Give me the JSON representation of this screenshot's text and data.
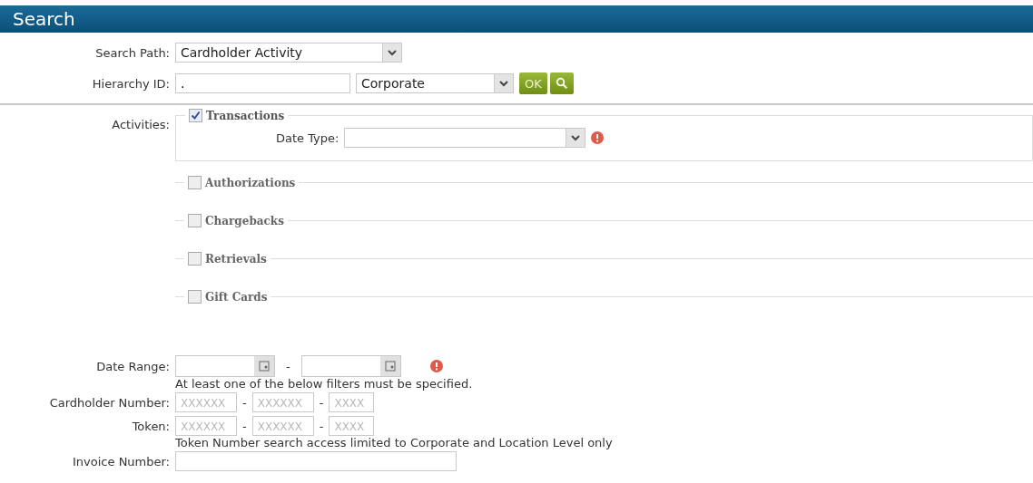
{
  "header": {
    "title": "Search"
  },
  "search_path": {
    "label": "Search Path:",
    "value": "Cardholder Activity"
  },
  "hierarchy": {
    "label": "Hierarchy ID:",
    "value": ".",
    "level_value": "Corporate",
    "ok_button": "OK"
  },
  "activities": {
    "label": "Activities:",
    "items": [
      {
        "label": "Transactions",
        "checked": true,
        "expanded": true,
        "date_type_label": "Date Type:",
        "required": true
      },
      {
        "label": "Authorizations",
        "checked": false,
        "expanded": false
      },
      {
        "label": "Chargebacks",
        "checked": false,
        "expanded": false
      },
      {
        "label": "Retrievals",
        "checked": false,
        "expanded": false
      },
      {
        "label": "Gift Cards",
        "checked": false,
        "expanded": false
      }
    ]
  },
  "date_range": {
    "label": "Date Range:",
    "separator": "-",
    "required": true
  },
  "filters_note": "At least one of the below filters must be specified.",
  "number_rows": [
    {
      "label": "Cardholder Number:",
      "placeholders": [
        "XXXXXX",
        "XXXXXX",
        "XXXX"
      ],
      "separators": [
        "-",
        "-"
      ]
    },
    {
      "label": "Token:",
      "placeholders": [
        "XXXXXX",
        "XXXXXX",
        "XXXX"
      ],
      "separators": [
        "-",
        "-"
      ]
    }
  ],
  "token_note": "Token Number search access limited to Corporate and Location Level only",
  "invoice": {
    "label": "Invoice Number:"
  }
}
